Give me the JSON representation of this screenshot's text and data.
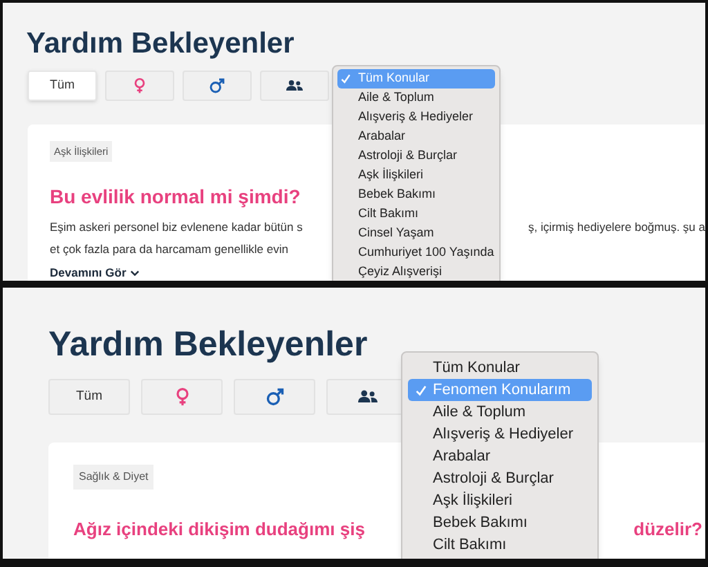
{
  "panels": [
    {
      "title": "Yardım Bekleyenler",
      "filters": [
        {
          "kind": "text",
          "label": "Tüm",
          "selected": true
        },
        {
          "kind": "female",
          "selected": false
        },
        {
          "kind": "male",
          "selected": false
        },
        {
          "kind": "group",
          "selected": false
        }
      ],
      "card": {
        "tag": "Aşk İlişkileri",
        "heading_parts": [
          "Bu evlilik normal mi şimdi?"
        ],
        "text_lines": [
          [
            "Eşim askeri personel biz evlenene kadar bütün s",
            "ş, içirmiş hediyelere boğmuş. şu a"
          ],
          [
            "et çok fazla para da harcamam genellikle evin"
          ]
        ],
        "more_link": "Devamını Gör"
      },
      "dropdown": [
        {
          "label": "Tüm Konular",
          "selected": true
        },
        {
          "label": "Aile & Toplum",
          "selected": false
        },
        {
          "label": "Alışveriş & Hediyeler",
          "selected": false
        },
        {
          "label": "Arabalar",
          "selected": false
        },
        {
          "label": "Astroloji & Burçlar",
          "selected": false
        },
        {
          "label": "Aşk İlişkileri",
          "selected": false
        },
        {
          "label": "Bebek Bakımı",
          "selected": false
        },
        {
          "label": "Cilt Bakımı",
          "selected": false
        },
        {
          "label": "Cinsel Yaşam",
          "selected": false
        },
        {
          "label": "Cumhuriyet 100 Yaşında",
          "selected": false
        },
        {
          "label": "Çeyiz Alışverişi",
          "selected": false
        }
      ]
    },
    {
      "title": "Yardım Bekleyenler",
      "filters": [
        {
          "kind": "text",
          "label": "Tüm",
          "selected": false
        },
        {
          "kind": "female",
          "selected": false
        },
        {
          "kind": "male",
          "selected": false
        },
        {
          "kind": "group",
          "selected": false
        }
      ],
      "card": {
        "tag": "Sağlık & Diyet",
        "heading_parts": [
          "Ağız içindeki dikişim dudağımı şiş",
          "düzelir?"
        ]
      },
      "dropdown": [
        {
          "label": "Tüm Konular",
          "selected": false
        },
        {
          "label": "Fenomen Konularım",
          "selected": true
        },
        {
          "label": "Aile & Toplum",
          "selected": false
        },
        {
          "label": "Alışveriş & Hediyeler",
          "selected": false
        },
        {
          "label": "Arabalar",
          "selected": false
        },
        {
          "label": "Astroloji & Burçlar",
          "selected": false
        },
        {
          "label": "Aşk İlişkileri",
          "selected": false
        },
        {
          "label": "Bebek Bakımı",
          "selected": false
        },
        {
          "label": "Cilt Bakımı",
          "selected": false
        }
      ]
    }
  ]
}
